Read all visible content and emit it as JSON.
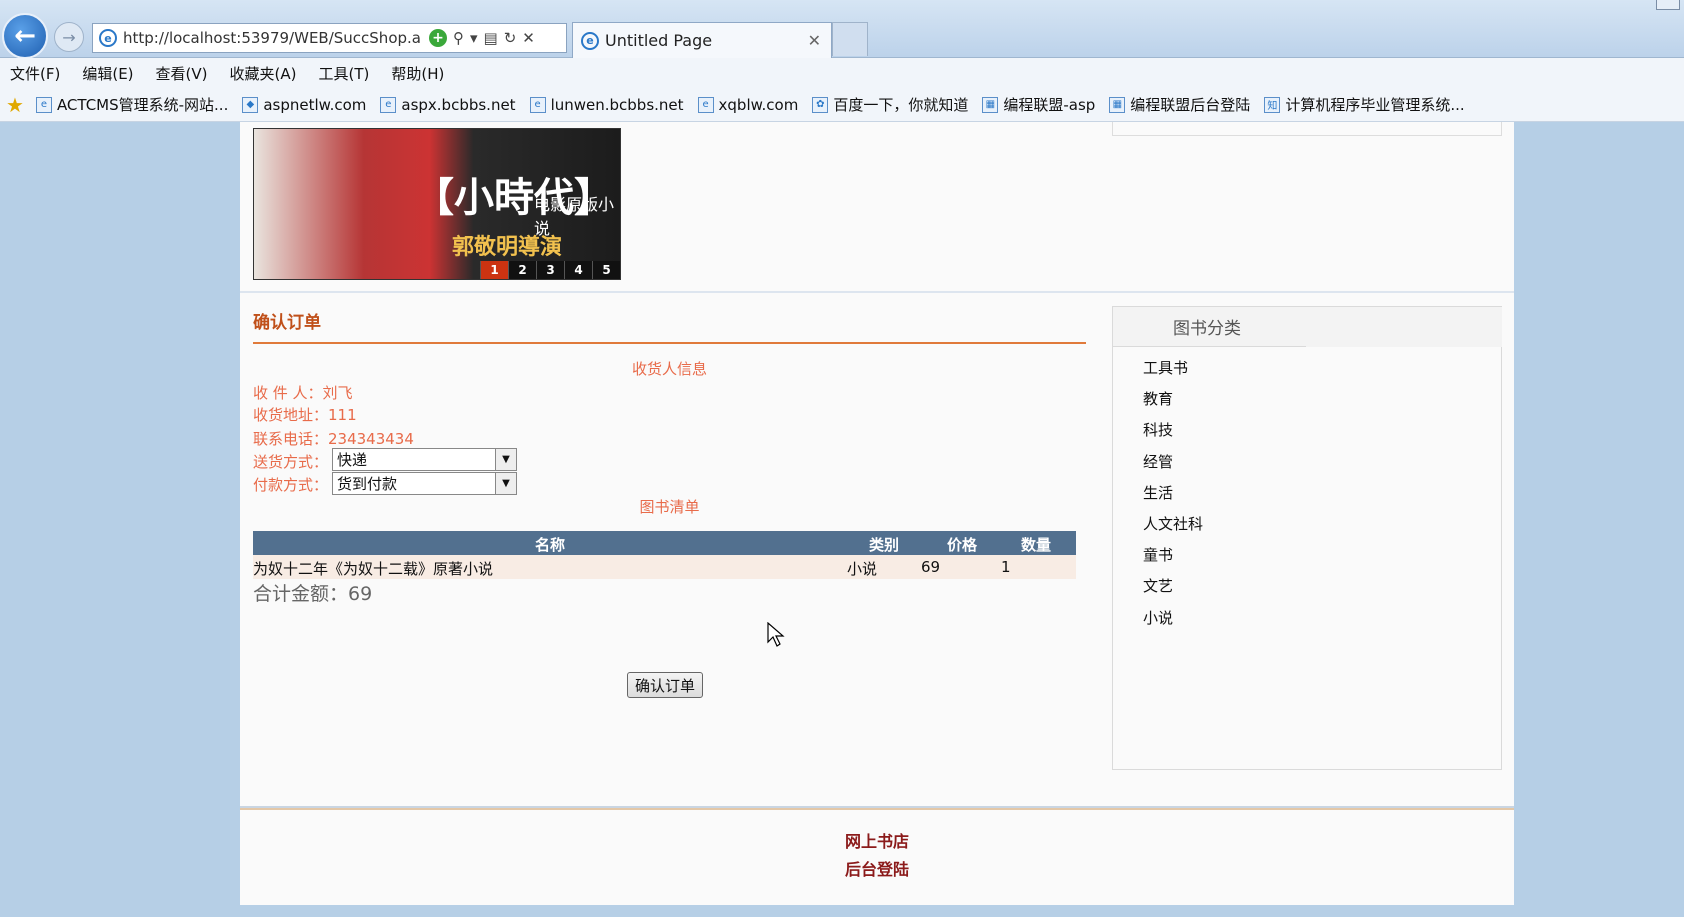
{
  "browser": {
    "address": "http://localhost:53979/WEB/SuccShop.a",
    "tab_title": "Untitled Page",
    "menu": [
      "文件(F)",
      "编辑(E)",
      "查看(V)",
      "收藏夹(A)",
      "工具(T)",
      "帮助(H)"
    ],
    "favorites": [
      "ACTCMS管理系统-网站...",
      "aspnetlw.com",
      "aspx.bcbbs.net",
      "lunwen.bcbbs.net",
      "xqblw.com",
      "百度一下，你就知道",
      "编程联盟-asp",
      "编程联盟后台登陆",
      "计算机程序毕业管理系统..."
    ]
  },
  "banner": {
    "title": "【小時代】",
    "subtitle": "电影原版小说",
    "director": "郭敬明導演",
    "pages": [
      "1",
      "2",
      "3",
      "4",
      "5"
    ]
  },
  "order": {
    "section_title": "确认订单",
    "receiver_heading": "收货人信息",
    "receiver": "收 件 人：刘飞",
    "address": "收货地址：111",
    "phone": "联系电话：234343434",
    "delivery_label": "送货方式：",
    "delivery_value": "快递",
    "payment_label": "付款方式：",
    "payment_value": "货到付款",
    "list_heading": "图书清单",
    "table": {
      "headers": [
        "名称",
        "类别",
        "价格",
        "数量"
      ],
      "rows": [
        {
          "name": "为奴十二年《为奴十二载》原著小说",
          "category": "小说",
          "price": "69",
          "qty": "1"
        }
      ]
    },
    "total": "合计金额：69",
    "confirm_label": "确认订单"
  },
  "sidebar": {
    "title": "图书分类",
    "categories": [
      "工具书",
      "教育",
      "科技",
      "经管",
      "生活",
      "人文社科",
      "童书",
      "文艺",
      "小说"
    ]
  },
  "footer": {
    "shop_link": "网上书店",
    "admin_link": "后台登陆"
  }
}
